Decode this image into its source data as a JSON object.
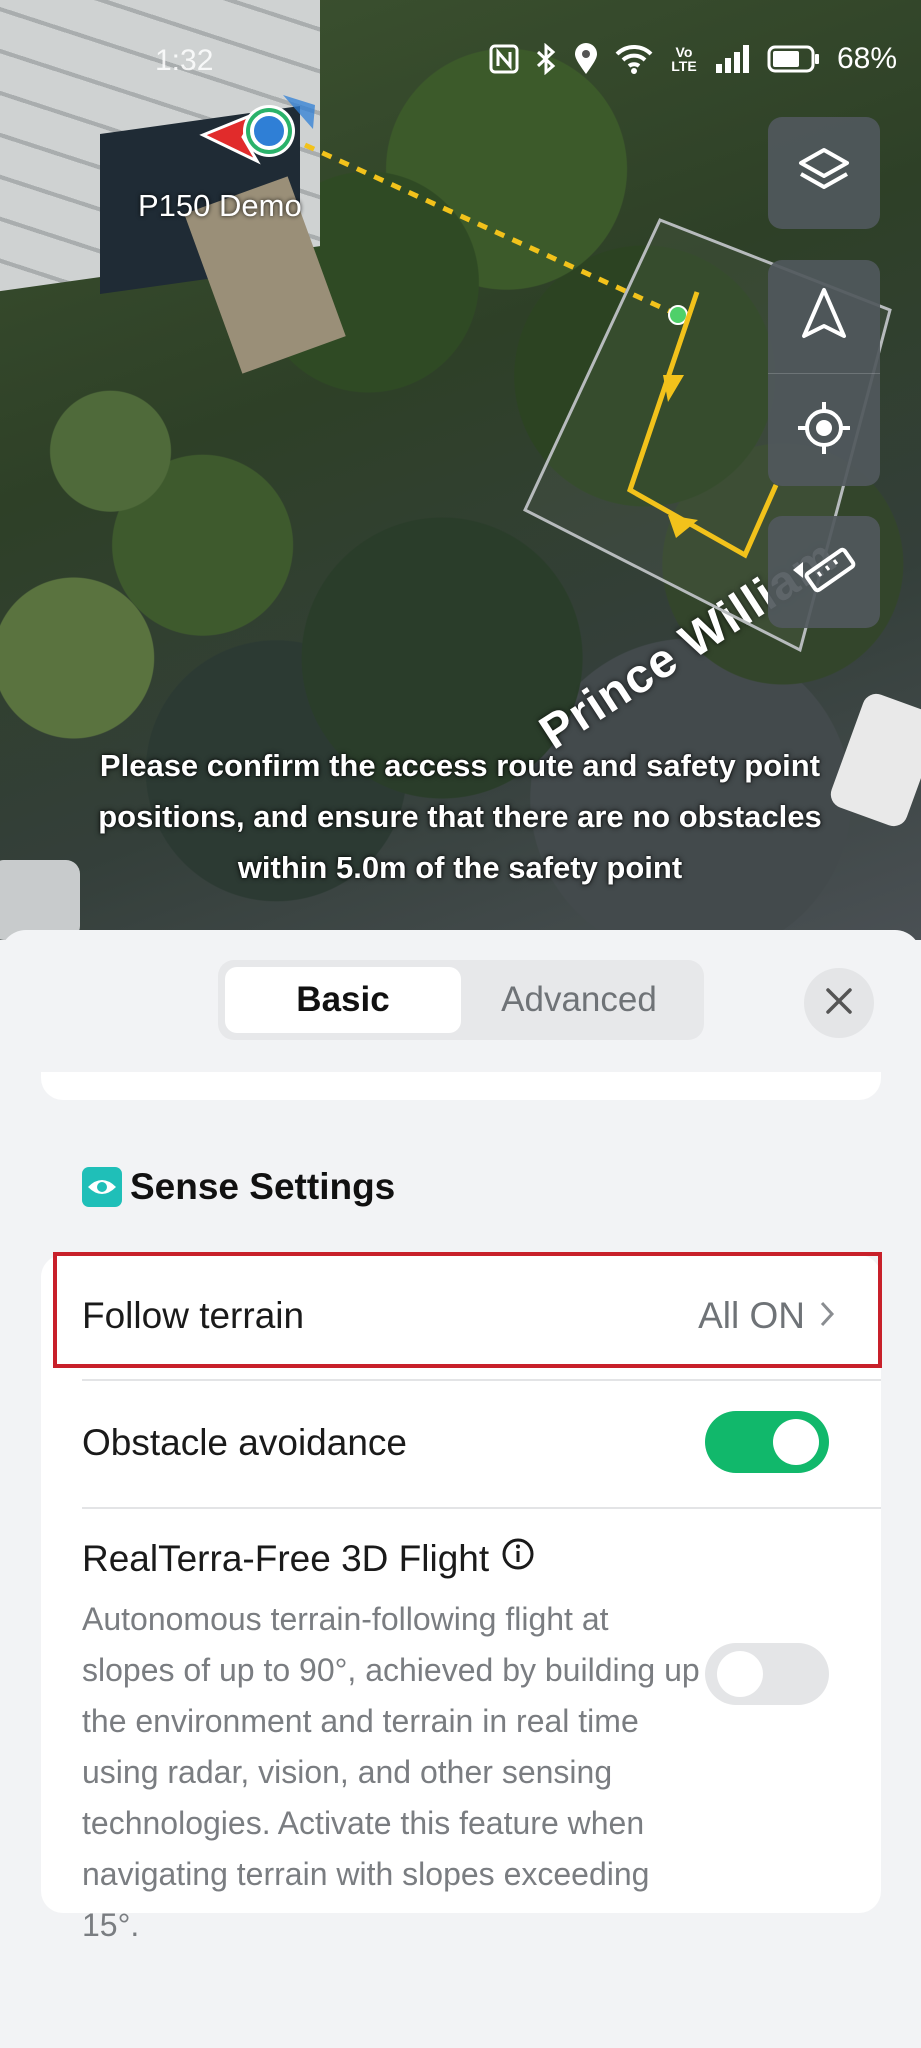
{
  "status_bar": {
    "time": "1:32",
    "battery": "68%",
    "icons": [
      "nfc-icon",
      "bluetooth-icon",
      "location-icon",
      "wifi-icon",
      "volte-icon",
      "signal-icon",
      "battery-icon"
    ],
    "volte_label": "Vo LTE"
  },
  "map": {
    "aircraft_name": "P150 Demo",
    "road_name": "Prince William",
    "notice": "Please confirm the access route and safety point positions, and ensure that there are no obstacles within 5.0m of the safety point",
    "tools": [
      "layers-icon",
      "compass-arrow-icon",
      "locate-icon",
      "ruler-icon"
    ],
    "route_color": "#f2c21b"
  },
  "sheet": {
    "tabs": [
      {
        "label": "Basic",
        "active": true
      },
      {
        "label": "Advanced",
        "active": false
      }
    ],
    "section_title": "Sense Settings",
    "follow_terrain": {
      "label": "Follow terrain",
      "value": "All ON"
    },
    "obstacle_avoidance": {
      "label": "Obstacle avoidance",
      "enabled": true
    },
    "realterra": {
      "label": "RealTerra-Free 3D Flight",
      "enabled": false,
      "description": "Autonomous terrain-following flight at slopes of up to 90°, achieved by building up the environment and terrain in real time using radar, vision, and other sensing technologies. Activate this feature when navigating terrain with slopes exceeding 15°."
    }
  },
  "colors": {
    "toggle_on": "#11b86b",
    "accent_teal": "#1fbfb8",
    "highlight_red": "#c8202a"
  }
}
